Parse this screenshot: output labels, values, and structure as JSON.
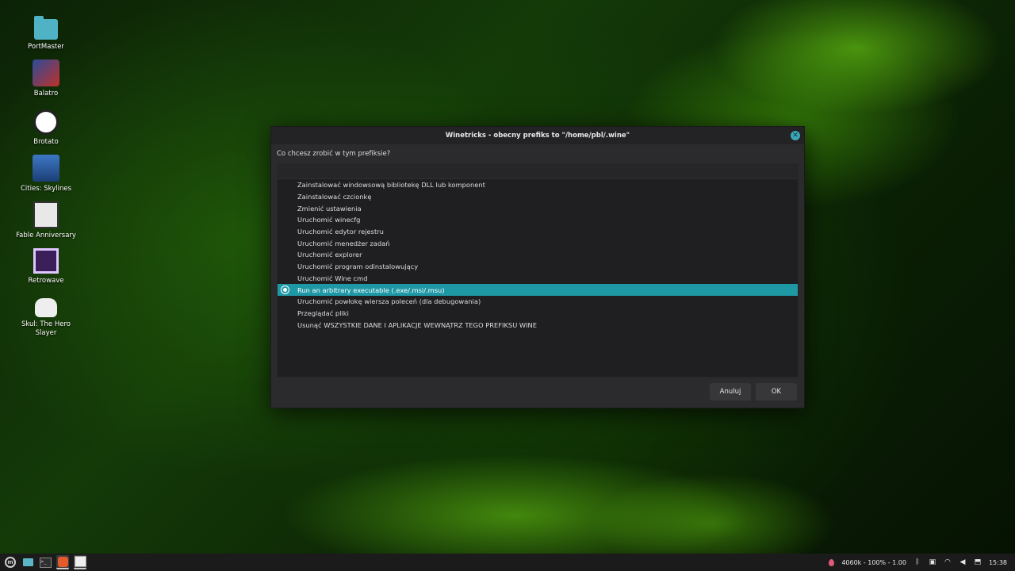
{
  "desktop": {
    "icons": [
      {
        "label": "PortMaster",
        "icon": "folder-icon"
      },
      {
        "label": "Balatro",
        "icon": "balatro-icon"
      },
      {
        "label": "Brotato",
        "icon": "brotato-icon"
      },
      {
        "label": "Cities: Skylines",
        "icon": "cities-skylines-icon"
      },
      {
        "label": "Fable Anniversary",
        "icon": "fable-icon"
      },
      {
        "label": "Retrowave",
        "icon": "retrowave-icon"
      },
      {
        "label": "Skul: The Hero Slayer",
        "icon": "skul-icon"
      }
    ]
  },
  "dialog": {
    "title": "Winetricks - obecny prefiks to \"/home/pbl/.wine\"",
    "prompt": "Co chcesz zrobić w tym prefiksie?",
    "options": [
      {
        "label": "Zainstalować windowsową bibliotekę DLL lub komponent",
        "selected": false
      },
      {
        "label": "Zainstalować czcionkę",
        "selected": false
      },
      {
        "label": "Zmienić ustawienia",
        "selected": false
      },
      {
        "label": "Uruchomić winecfg",
        "selected": false
      },
      {
        "label": "Uruchomić edytor rejestru",
        "selected": false
      },
      {
        "label": "Uruchomić menedżer zadań",
        "selected": false
      },
      {
        "label": "Uruchomić explorer",
        "selected": false
      },
      {
        "label": "Uruchomić program odinstalowujący",
        "selected": false
      },
      {
        "label": "Uruchomić Wine cmd",
        "selected": false
      },
      {
        "label": "Run an arbitrary executable (.exe/.msi/.msu)",
        "selected": true
      },
      {
        "label": "Uruchomić powłokę wiersza poleceń (dla debugowania)",
        "selected": false
      },
      {
        "label": "Przeglądać pliki",
        "selected": false
      },
      {
        "label": "Usunąć WSZYSTKIE DANE I APLIKACJE WEWNĄTRZ TEGO PREFIKSU WINE",
        "selected": false
      }
    ],
    "cancel_label": "Anuluj",
    "ok_label": "OK"
  },
  "taskbar": {
    "status_text": "4060k - 100% - 1.00",
    "clock": "15:38"
  },
  "colors": {
    "accent": "#1f98a6",
    "dialog_bg": "#2b2b2d"
  }
}
